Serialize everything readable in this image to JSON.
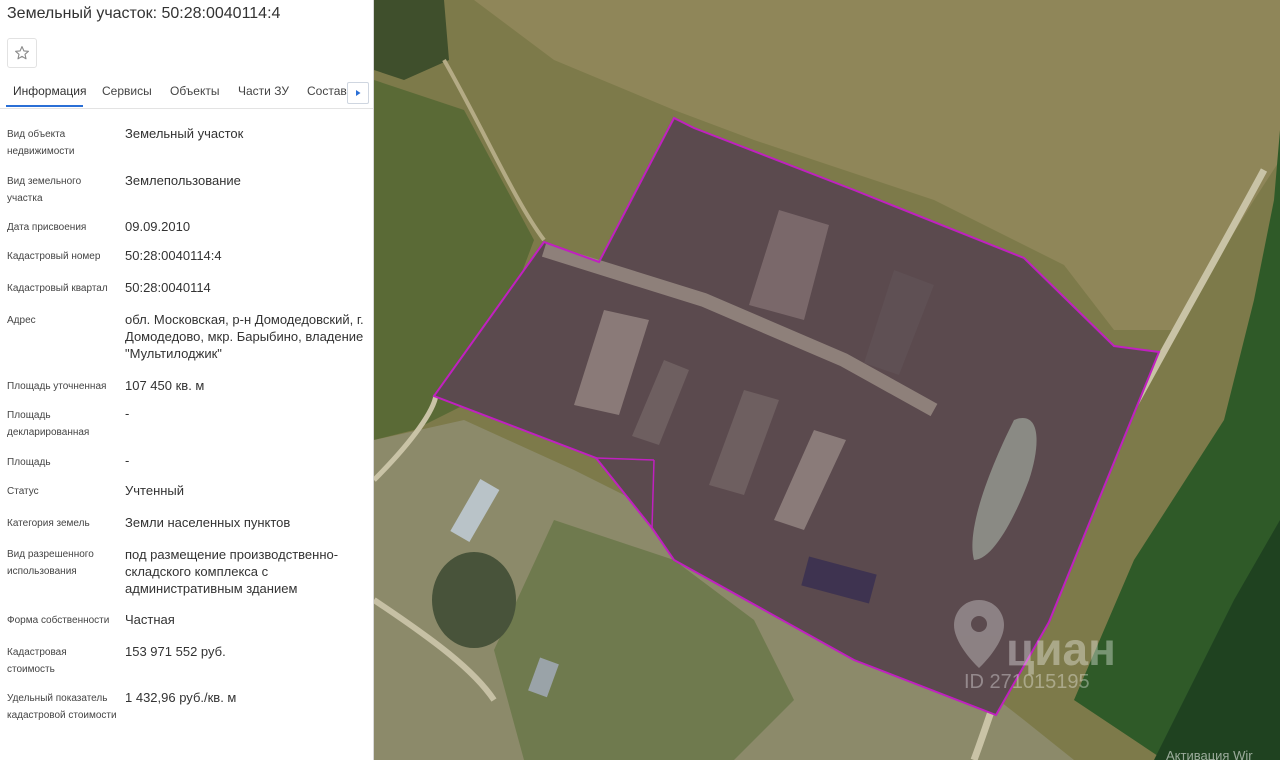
{
  "header": {
    "title": "Земельный участок: 50:28:0040114:4"
  },
  "tabs": [
    {
      "label": "Информация",
      "active": true
    },
    {
      "label": "Сервисы"
    },
    {
      "label": "Объекты"
    },
    {
      "label": "Части ЗУ"
    },
    {
      "label": "Состав"
    }
  ],
  "fields": [
    {
      "label": "Вид объекта недвижимости",
      "value": "Земельный участок"
    },
    {
      "label": "Вид земельного участка",
      "value": "Землепользование"
    },
    {
      "label": "Дата присвоения",
      "value": "09.09.2010"
    },
    {
      "label": "Кадастровый номер",
      "value": "50:28:0040114:4"
    },
    {
      "label": "Кадастровый квартал",
      "value": "50:28:0040114"
    },
    {
      "label": "Адрес",
      "value": "обл. Московская, р-н Домодедовский, г. Домодедово, мкр. Барыбино, владение \"Мультилоджик\""
    },
    {
      "label": "Площадь уточненная",
      "value": "107 450 кв. м"
    },
    {
      "label": "Площадь декларированная",
      "value": "-"
    },
    {
      "label": "Площадь",
      "value": "-"
    },
    {
      "label": "Статус",
      "value": "Учтенный"
    },
    {
      "label": "Категория земель",
      "value": "Земли населенных пунктов"
    },
    {
      "label": "Вид разрешенного использования",
      "value": "под размещение производственно-складского комплекса с административным зданием"
    },
    {
      "label": "Форма собственности",
      "value": "Частная"
    },
    {
      "label": "Кадастровая стоимость",
      "value": "153 971 552 руб."
    },
    {
      "label": "Удельный показатель кадастровой стоимости",
      "value": "1 432,96 руб./кв. м"
    }
  ],
  "map": {
    "watermark_logo": "циан",
    "watermark_id": "ID 271015195",
    "activation_text": "Активация Wir",
    "parcel_color": "#c020c0"
  },
  "icons": {
    "favorite": "star-icon",
    "tabs_next": "caret-right-icon"
  }
}
